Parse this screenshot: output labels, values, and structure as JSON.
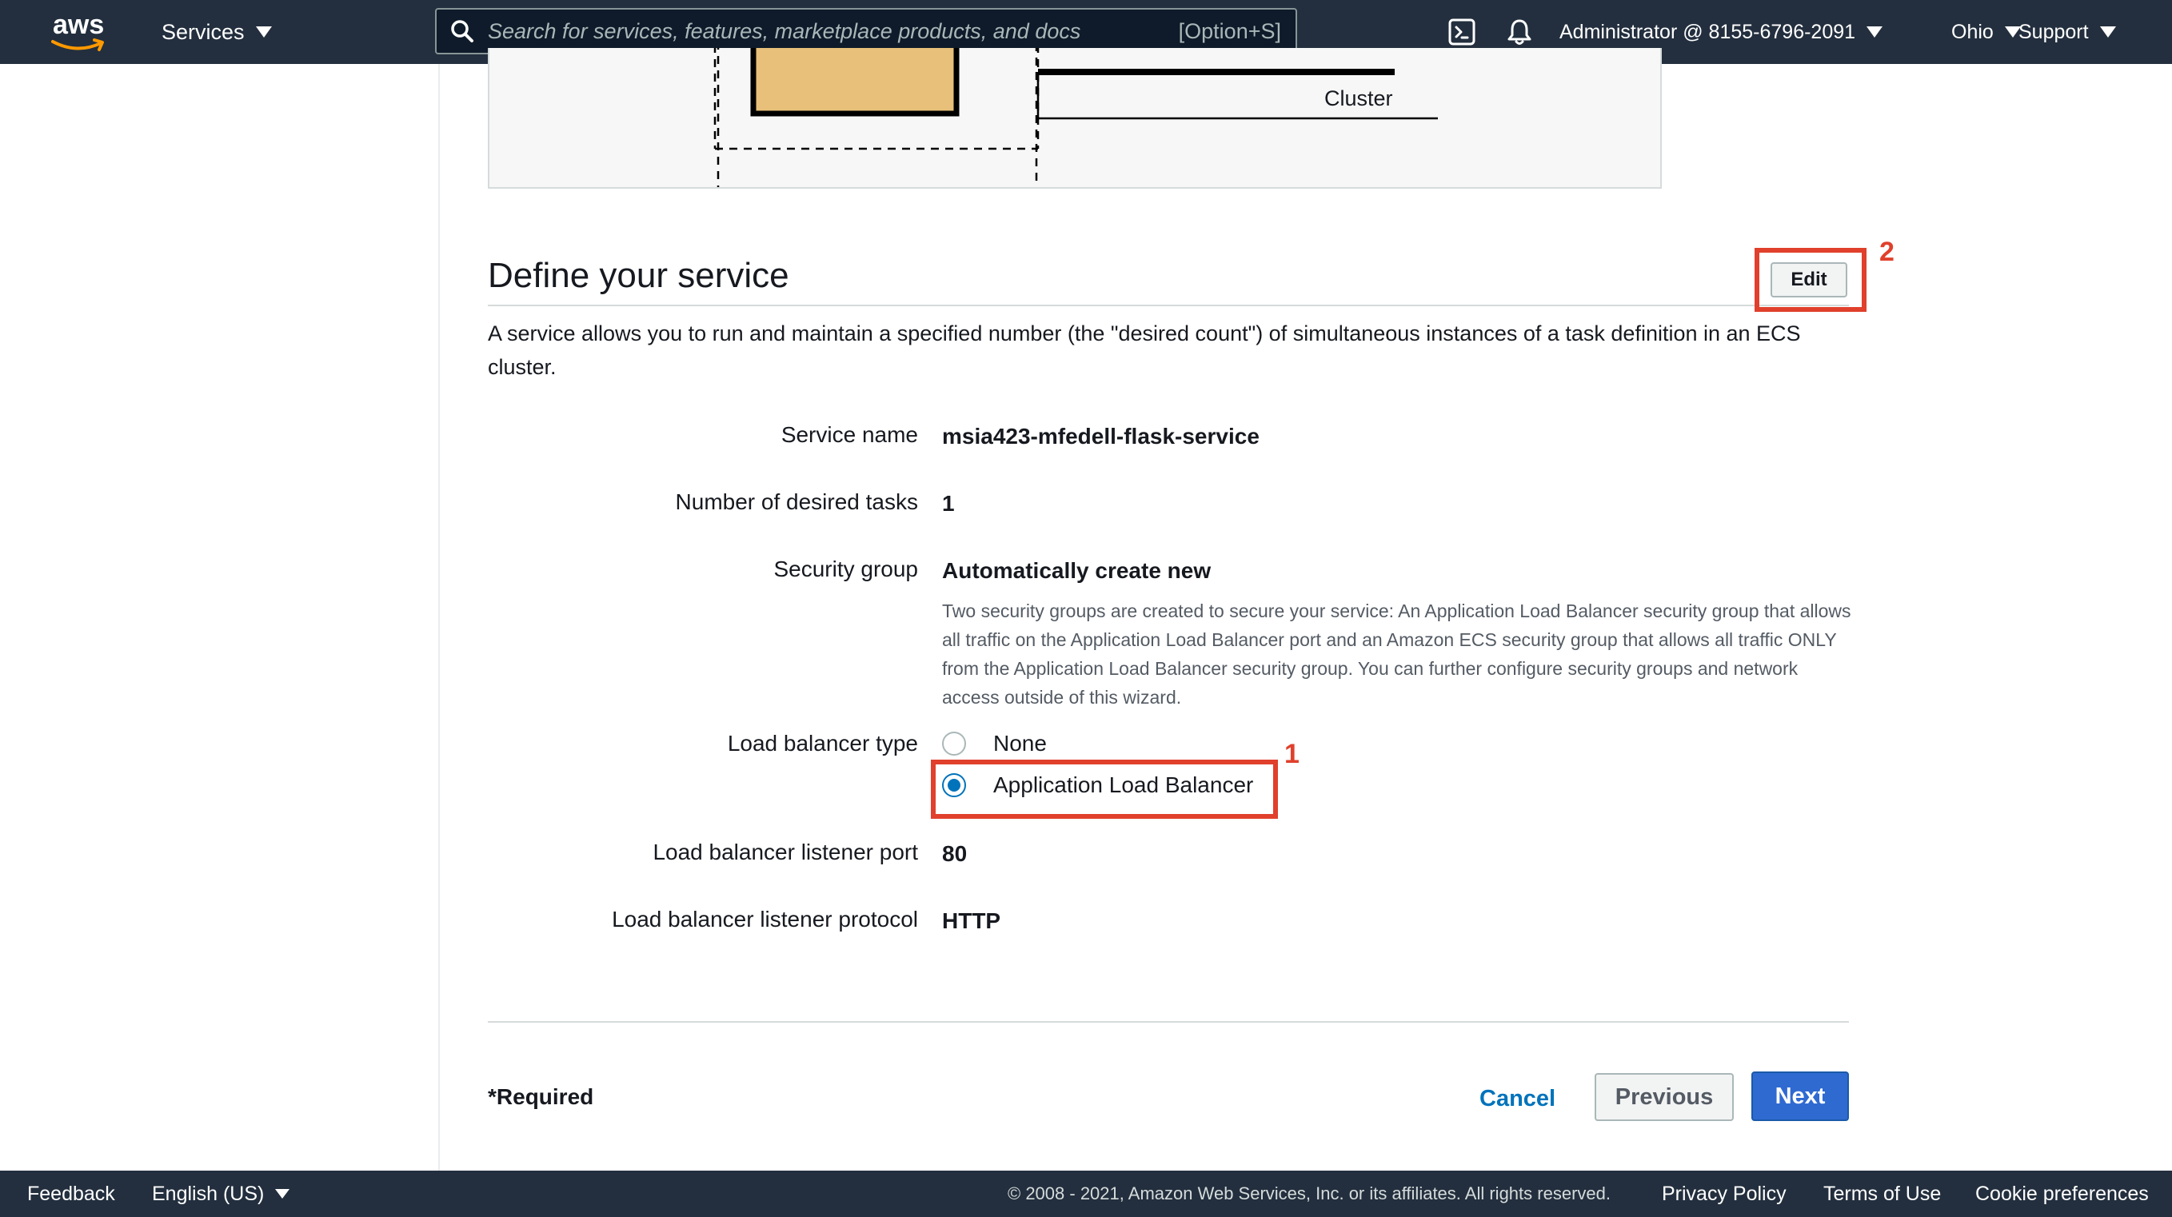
{
  "topnav": {
    "logo_text": "aws",
    "services_label": "Services",
    "search_placeholder": "Search for services, features, marketplace products, and docs",
    "search_shortcut": "[Option+S]",
    "account_label": "Administrator @ 8155-6796-2091",
    "region_label": "Ohio",
    "support_label": "Support"
  },
  "diagram": {
    "cluster_label": "Cluster"
  },
  "section": {
    "title": "Define your service",
    "edit_label": "Edit",
    "description": "A service allows you to run and maintain a specified number (the \"desired count\") of simultaneous instances of a task definition in an ECS cluster."
  },
  "fields": {
    "service_name_label": "Service name",
    "service_name_value": "msia423-mfedell-flask-service",
    "desired_tasks_label": "Number of desired tasks",
    "desired_tasks_value": "1",
    "security_group_label": "Security group",
    "security_group_value": "Automatically create new",
    "security_group_note": "Two security groups are created to secure your service: An Application Load Balancer security group that allows all traffic on the Application Load Balancer port and an Amazon ECS security group that allows all traffic ONLY from the Application Load Balancer security group. You can further configure security groups and network access outside of this wizard.",
    "lb_type_label": "Load balancer type",
    "lb_options": [
      "None",
      "Application Load Balancer"
    ],
    "lb_selected": "Application Load Balancer",
    "listener_port_label": "Load balancer listener port",
    "listener_port_value": "80",
    "listener_protocol_label": "Load balancer listener protocol",
    "listener_protocol_value": "HTTP"
  },
  "annotations": {
    "one": "1",
    "two": "2",
    "color": "#e0402c"
  },
  "actions": {
    "required_label": "*Required",
    "cancel_label": "Cancel",
    "previous_label": "Previous",
    "next_label": "Next"
  },
  "footer": {
    "feedback_label": "Feedback",
    "language_label": "English (US)",
    "copyright": "© 2008 - 2021, Amazon Web Services, Inc. or its affiliates. All rights reserved.",
    "privacy_label": "Privacy Policy",
    "terms_label": "Terms of Use",
    "cookie_label": "Cookie preferences"
  },
  "colors": {
    "nav_bg": "#232f3e",
    "primary_button": "#2f6ad1",
    "link": "#0073bb",
    "aws_orange": "#ff9900"
  },
  "icons": [
    "aws-logo",
    "search-icon",
    "cloudshell-icon",
    "bell-icon",
    "caret-down-icon",
    "radio-icon"
  ]
}
